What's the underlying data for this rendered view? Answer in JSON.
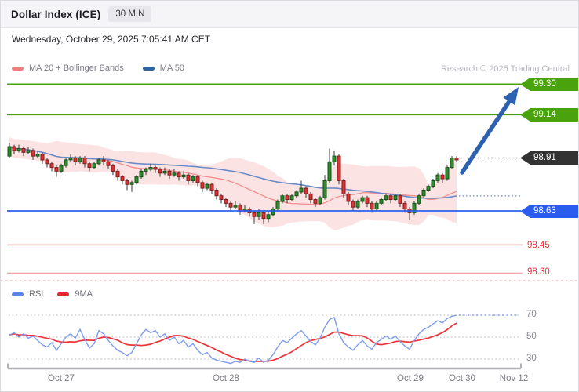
{
  "header": {
    "title": "Dollar Index (ICE)",
    "interval_badge": "30 MIN"
  },
  "timestamp": "Wednesday, October 29, 2025 7:05:41 AM CET",
  "main_legend": {
    "ma20_bb": "MA 20 + Bollinger Bands",
    "ma50": "MA 50",
    "research": "Research © 2025 Trading Central"
  },
  "rsi_legend": {
    "rsi": "RSI",
    "ma9": "9MA"
  },
  "labels": {
    "r2": "99.30",
    "r1": "99.14",
    "last": "98.91",
    "s1": "98.63",
    "m1": "98.45",
    "m2": "98.30"
  },
  "rsi_axis": [
    "70",
    "50",
    "30"
  ],
  "colors": {
    "resistance_green": "#4aa30d",
    "support_blue": "#2a5cf0",
    "minor_pink": "#f5a3a3",
    "last_dark": "#333333",
    "candle_up": "#2e8b2e",
    "candle_down": "#dd3333",
    "ma20": "#f09090",
    "ma50": "#6c8cc7",
    "bb_fill": "rgba(244,154,154,0.28)",
    "rsi_line": "#7f9ceb",
    "rsi_ma": "#ee3338",
    "arrow_blue": "#2d62b0"
  },
  "chart_data": [
    {
      "type": "candlestick",
      "title": "Dollar Index (ICE) 30 MIN",
      "x_axis": {
        "labels": [
          "Oct 27",
          "Oct 28",
          "Oct 29",
          "Oct 30",
          "Nov 12"
        ]
      },
      "levels": {
        "resistance": [
          99.3,
          99.14
        ],
        "last_price": 98.91,
        "support": 98.63,
        "minor_support": [
          98.45,
          98.3
        ]
      },
      "indicators": [
        {
          "name": "MA 20 + Bollinger Bands",
          "type": "sma+bands",
          "period": 20
        },
        {
          "name": "MA 50",
          "type": "sma",
          "period": 50
        }
      ],
      "projection": "blue arrow up from last price 98.91 toward resistance 99.30",
      "candles_ohlc": [
        [
          98.92,
          98.99,
          98.91,
          98.97
        ],
        [
          98.97,
          98.98,
          98.93,
          98.95
        ],
        [
          98.95,
          98.98,
          98.94,
          98.96
        ],
        [
          98.96,
          98.97,
          98.92,
          98.94
        ],
        [
          98.94,
          98.97,
          98.93,
          98.95
        ],
        [
          98.95,
          98.96,
          98.9,
          98.92
        ],
        [
          98.92,
          98.95,
          98.91,
          98.93
        ],
        [
          98.93,
          98.94,
          98.88,
          98.9
        ],
        [
          98.9,
          98.91,
          98.86,
          98.88
        ],
        [
          98.88,
          98.89,
          98.84,
          98.86
        ],
        [
          98.86,
          98.87,
          98.81,
          98.84
        ],
        [
          98.84,
          98.88,
          98.83,
          98.87
        ],
        [
          98.87,
          98.91,
          98.86,
          98.9
        ],
        [
          98.9,
          98.93,
          98.89,
          98.91
        ],
        [
          98.91,
          98.92,
          98.87,
          98.89
        ],
        [
          98.89,
          98.92,
          98.88,
          98.91
        ],
        [
          98.91,
          98.92,
          98.86,
          98.88
        ],
        [
          98.88,
          98.89,
          98.84,
          98.86
        ],
        [
          98.86,
          98.89,
          98.85,
          98.88
        ],
        [
          98.88,
          98.91,
          98.87,
          98.9
        ],
        [
          98.9,
          98.92,
          98.87,
          98.89
        ],
        [
          98.89,
          98.9,
          98.85,
          98.87
        ],
        [
          98.87,
          98.88,
          98.82,
          98.84
        ],
        [
          98.84,
          98.85,
          98.79,
          98.81
        ],
        [
          98.81,
          98.82,
          98.77,
          98.79
        ],
        [
          98.79,
          98.8,
          98.74,
          98.77
        ],
        [
          98.77,
          98.79,
          98.73,
          98.78
        ],
        [
          98.78,
          98.82,
          98.77,
          98.81
        ],
        [
          98.81,
          98.85,
          98.8,
          98.84
        ],
        [
          98.84,
          98.86,
          98.82,
          98.85
        ],
        [
          98.85,
          98.88,
          98.84,
          98.86
        ],
        [
          98.86,
          98.87,
          98.83,
          98.85
        ],
        [
          98.85,
          98.86,
          98.81,
          98.83
        ],
        [
          98.83,
          98.86,
          98.82,
          98.84
        ],
        [
          98.84,
          98.85,
          98.8,
          98.82
        ],
        [
          98.82,
          98.85,
          98.81,
          98.83
        ],
        [
          98.83,
          98.84,
          98.79,
          98.81
        ],
        [
          98.81,
          98.84,
          98.8,
          98.82
        ],
        [
          98.82,
          98.83,
          98.77,
          98.79
        ],
        [
          98.79,
          98.82,
          98.78,
          98.81
        ],
        [
          98.81,
          98.82,
          98.76,
          98.78
        ],
        [
          98.78,
          98.79,
          98.73,
          98.75
        ],
        [
          98.75,
          98.78,
          98.74,
          98.77
        ],
        [
          98.77,
          98.78,
          98.72,
          98.74
        ],
        [
          98.74,
          98.75,
          98.69,
          98.71
        ],
        [
          98.71,
          98.72,
          98.67,
          98.69
        ],
        [
          98.69,
          98.7,
          98.65,
          98.67
        ],
        [
          98.67,
          98.68,
          98.63,
          98.65
        ],
        [
          98.65,
          98.68,
          98.64,
          98.66
        ],
        [
          98.66,
          98.67,
          98.61,
          98.63
        ],
        [
          98.63,
          98.66,
          98.62,
          98.64
        ],
        [
          98.64,
          98.65,
          98.6,
          98.62
        ],
        [
          98.62,
          98.63,
          98.56,
          98.6
        ],
        [
          98.6,
          98.64,
          98.58,
          98.62
        ],
        [
          98.62,
          98.63,
          98.56,
          98.59
        ],
        [
          98.59,
          98.63,
          98.57,
          98.61
        ],
        [
          98.61,
          98.65,
          98.6,
          98.64
        ],
        [
          98.64,
          98.69,
          98.63,
          98.68
        ],
        [
          98.68,
          98.72,
          98.67,
          98.71
        ],
        [
          98.71,
          98.72,
          98.67,
          98.69
        ],
        [
          98.69,
          98.72,
          98.68,
          98.71
        ],
        [
          98.71,
          98.74,
          98.7,
          98.73
        ],
        [
          98.73,
          98.79,
          98.72,
          98.75
        ],
        [
          98.75,
          98.76,
          98.7,
          98.72
        ],
        [
          98.72,
          98.73,
          98.67,
          98.69
        ],
        [
          98.69,
          98.7,
          98.65,
          98.67
        ],
        [
          98.67,
          98.71,
          98.66,
          98.7
        ],
        [
          98.7,
          98.82,
          98.69,
          98.79
        ],
        [
          98.79,
          98.96,
          98.78,
          98.89
        ],
        [
          98.89,
          98.95,
          98.87,
          98.92
        ],
        [
          98.92,
          98.93,
          98.77,
          98.79
        ],
        [
          98.79,
          98.8,
          98.7,
          98.72
        ],
        [
          98.72,
          98.73,
          98.66,
          98.68
        ],
        [
          98.68,
          98.69,
          98.63,
          98.65
        ],
        [
          98.65,
          98.69,
          98.64,
          98.68
        ],
        [
          98.68,
          98.71,
          98.67,
          98.7
        ],
        [
          98.7,
          98.71,
          98.65,
          98.67
        ],
        [
          98.67,
          98.68,
          98.62,
          98.64
        ],
        [
          98.64,
          98.68,
          98.63,
          98.67
        ],
        [
          98.67,
          98.7,
          98.66,
          98.69
        ],
        [
          98.69,
          98.72,
          98.68,
          98.71
        ],
        [
          98.71,
          98.72,
          98.67,
          98.69
        ],
        [
          98.69,
          98.72,
          98.68,
          98.71
        ],
        [
          98.71,
          98.72,
          98.65,
          98.67
        ],
        [
          98.67,
          98.68,
          98.62,
          98.64
        ],
        [
          98.64,
          98.65,
          98.58,
          98.62
        ],
        [
          98.62,
          98.68,
          98.61,
          98.67
        ],
        [
          98.67,
          98.72,
          98.66,
          98.71
        ],
        [
          98.71,
          98.75,
          98.7,
          98.74
        ],
        [
          98.74,
          98.77,
          98.73,
          98.76
        ],
        [
          98.76,
          98.8,
          98.75,
          98.79
        ],
        [
          98.79,
          98.83,
          98.78,
          98.82
        ],
        [
          98.82,
          98.83,
          98.78,
          98.8
        ],
        [
          98.8,
          98.87,
          98.79,
          98.86
        ],
        [
          98.86,
          98.92,
          98.85,
          98.91
        ],
        [
          98.91,
          98.92,
          98.89,
          98.9
        ]
      ]
    },
    {
      "type": "line",
      "name": "RSI panel",
      "gridlines": [
        70,
        50,
        30
      ],
      "series": [
        {
          "name": "RSI",
          "values": [
            52,
            54,
            50,
            53,
            49,
            51,
            47,
            43,
            41,
            45,
            38,
            44,
            50,
            53,
            49,
            57,
            48,
            40,
            44,
            56,
            53,
            47,
            42,
            38,
            36,
            33,
            36,
            44,
            52,
            57,
            54,
            56,
            50,
            53,
            47,
            50,
            44,
            47,
            41,
            44,
            38,
            34,
            36,
            31,
            29,
            28,
            27,
            26,
            28,
            27,
            30,
            28,
            27,
            31,
            27,
            29,
            34,
            41,
            47,
            45,
            49,
            53,
            56,
            51,
            46,
            43,
            49,
            59,
            66,
            68,
            53,
            45,
            41,
            38,
            43,
            47,
            42,
            39,
            45,
            48,
            51,
            48,
            51,
            46,
            42,
            39,
            47,
            53,
            57,
            59,
            62,
            65,
            63,
            67,
            69,
            70
          ]
        },
        {
          "name": "9MA",
          "derived": "9-period SMA of RSI"
        }
      ]
    }
  ]
}
